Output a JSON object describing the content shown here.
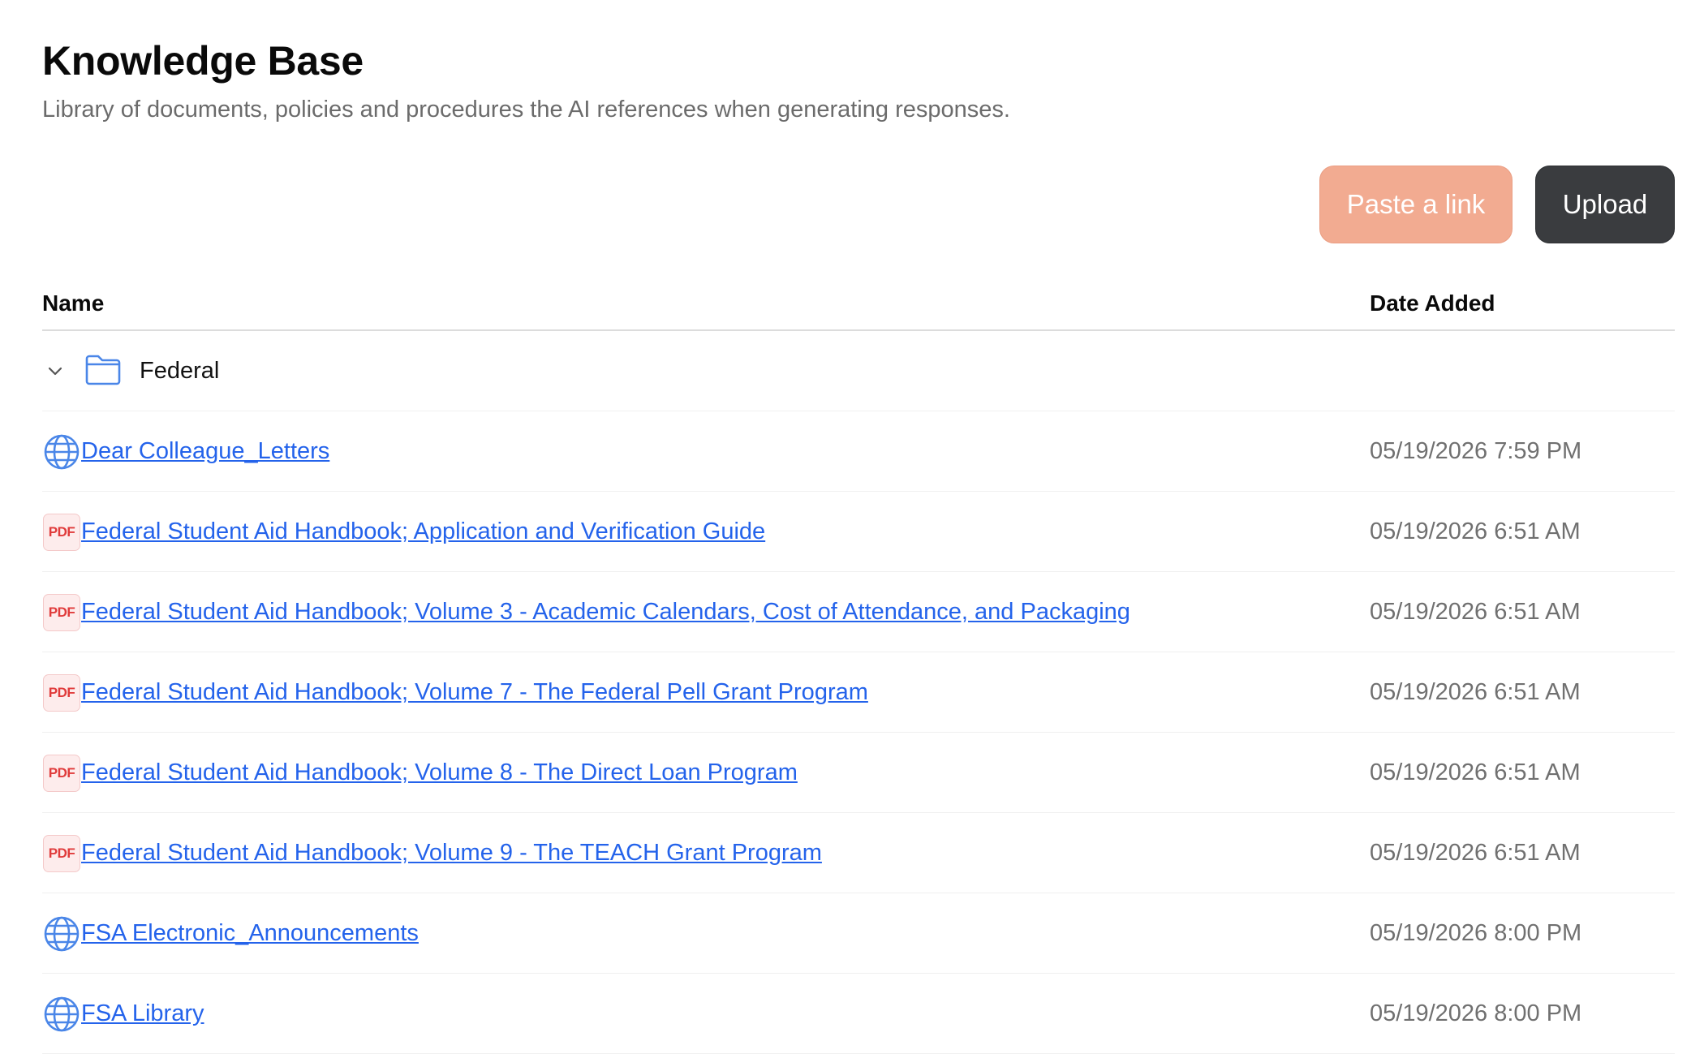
{
  "header": {
    "title": "Knowledge Base",
    "subtitle": "Library of documents, policies and procedures the AI references when generating responses."
  },
  "actions": {
    "paste_link_label": "Paste a link",
    "upload_label": "Upload"
  },
  "table": {
    "columns": {
      "name": "Name",
      "date_added": "Date Added"
    },
    "folder": {
      "name": "Federal",
      "expanded": true
    },
    "rows": [
      {
        "type": "web",
        "name": "Dear Colleague_Letters",
        "date": "05/19/2026 7:59 PM"
      },
      {
        "type": "pdf",
        "name": "Federal Student Aid Handbook; Application and Verification Guide",
        "date": "05/19/2026 6:51 AM"
      },
      {
        "type": "pdf",
        "name": "Federal Student Aid Handbook; Volume 3 - Academic Calendars, Cost of Attendance, and Packaging",
        "date": "05/19/2026 6:51 AM"
      },
      {
        "type": "pdf",
        "name": "Federal Student Aid Handbook; Volume 7 - The Federal Pell Grant Program",
        "date": "05/19/2026 6:51 AM"
      },
      {
        "type": "pdf",
        "name": "Federal Student Aid Handbook; Volume 8 - The Direct Loan Program",
        "date": "05/19/2026 6:51 AM"
      },
      {
        "type": "pdf",
        "name": "Federal Student Aid Handbook; Volume 9 - The TEACH Grant Program",
        "date": "05/19/2026 6:51 AM"
      },
      {
        "type": "web",
        "name": "FSA Electronic_Announcements",
        "date": "05/19/2026 8:00 PM"
      },
      {
        "type": "web",
        "name": "FSA Library",
        "date": "05/19/2026 8:00 PM"
      }
    ]
  },
  "icons": {
    "pdf_badge_text": "PDF"
  },
  "colors": {
    "link": "#2463eb",
    "paste_link_button": "#f2ab91",
    "upload_button": "#3a3c3f",
    "globe_icon": "#4a86e8",
    "folder_icon": "#4a86e8",
    "pdf_badge": "#e03b3b"
  }
}
